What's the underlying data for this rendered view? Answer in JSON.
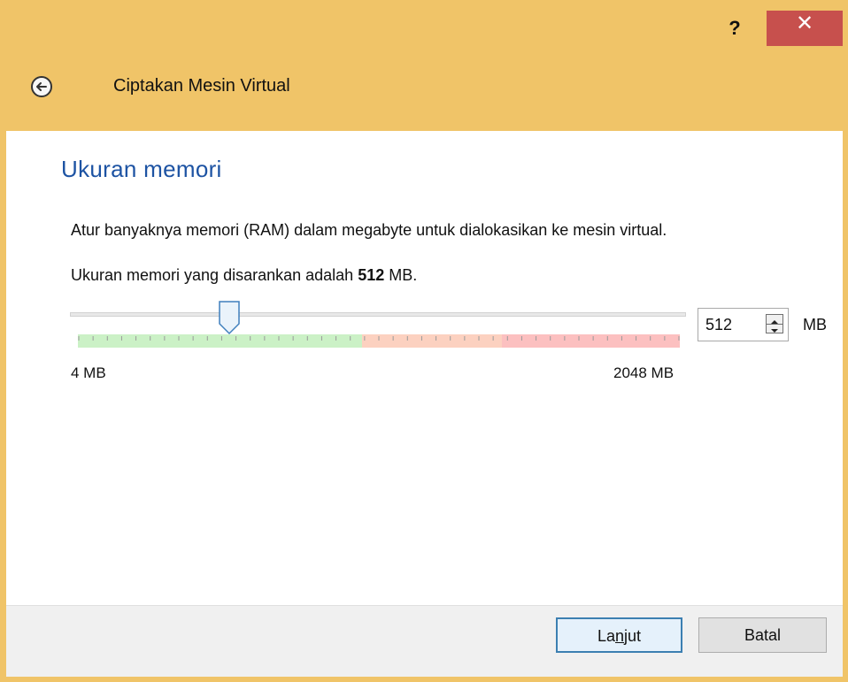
{
  "titlebar": {
    "help_label": "?",
    "close_label": "✕"
  },
  "wizard": {
    "title": "Ciptakan Mesin Virtual",
    "back_icon": "back-arrow-icon"
  },
  "page": {
    "heading": "Ukuran memori",
    "description": "Atur banyaknya memori (RAM) dalam megabyte untuk dialokasikan ke mesin virtual.",
    "recommend_prefix": "Ukuran memori yang disarankan adalah ",
    "recommend_value": "512",
    "recommend_suffix": " MB."
  },
  "memory": {
    "min_label": "4 MB",
    "max_label": "2048 MB",
    "min_value": 4,
    "max_value": 2048,
    "current_value": "512",
    "unit": "MB",
    "zone_colors": {
      "green": "#cbf1c6",
      "orange": "#fcd1c0",
      "red": "#fcc0c0"
    }
  },
  "buttons": {
    "next_pre": "La",
    "next_underlined": "n",
    "next_post": "jut",
    "cancel": "Batal"
  },
  "colors": {
    "window_frame": "#f0c468",
    "close_button": "#c7504d",
    "heading": "#1d53a3",
    "default_button_border": "#3c7fb1"
  }
}
